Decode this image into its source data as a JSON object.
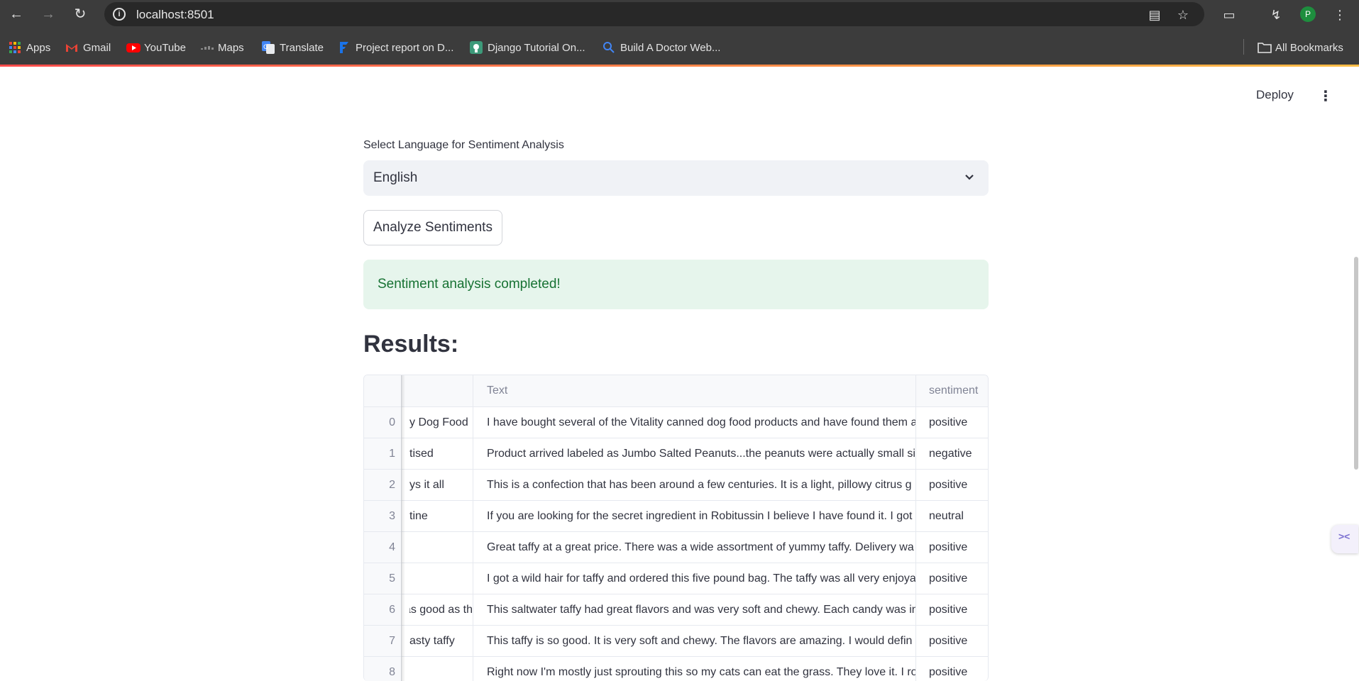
{
  "browser": {
    "url": "localhost:8501",
    "profile_initial": "P",
    "bookmarks": [
      {
        "label": "Apps",
        "icon": "apps-grid-icon",
        "color": "#ea4335"
      },
      {
        "label": "Gmail",
        "icon": "gmail-icon",
        "color": "#ea4335"
      },
      {
        "label": "YouTube",
        "icon": "youtube-icon",
        "color": "#ff0000"
      },
      {
        "label": "Maps",
        "icon": "maps-icon",
        "color": "#8a8a8a"
      },
      {
        "label": "Translate",
        "icon": "translate-icon",
        "color": "#4285f4"
      },
      {
        "label": "Project report on D...",
        "icon": "project-report-icon",
        "color": "#1a73e8"
      },
      {
        "label": "Django Tutorial On...",
        "icon": "django-icon",
        "color": "#3d9a7a"
      },
      {
        "label": "Build A Doctor Web...",
        "icon": "search-icon",
        "color": "#4285f4"
      }
    ],
    "all_bookmarks": "All Bookmarks"
  },
  "app": {
    "deploy_label": "Deploy",
    "select_label": "Select Language for Sentiment Analysis",
    "select_value": "English",
    "analyze_button": "Analyze Sentiments",
    "success_message": "Sentiment analysis completed!",
    "results_title": "Results:"
  },
  "table": {
    "columns": [
      "Text",
      "sentiment"
    ],
    "rows": [
      {
        "index": "0",
        "summary": "y Dog Food",
        "text": "I have bought several of the Vitality canned dog food products and have found them a",
        "sentiment": "positive"
      },
      {
        "index": "1",
        "summary": "tised",
        "text": "Product arrived labeled as Jumbo Salted Peanuts...the peanuts were actually small si",
        "sentiment": "negative"
      },
      {
        "index": "2",
        "summary": "ys it all",
        "text": "This is a confection that has been around a few centuries.  It is a light, pillowy citrus g",
        "sentiment": "positive"
      },
      {
        "index": "3",
        "summary": "tine",
        "text": "If you are looking for the secret ingredient in Robitussin I believe I have found it.  I got",
        "sentiment": "neutral"
      },
      {
        "index": "4",
        "summary": "",
        "text": "Great taffy at a great price.  There was a wide assortment of yummy taffy.  Delivery wa",
        "sentiment": "positive"
      },
      {
        "index": "5",
        "summary": "",
        "text": "I got a wild hair for taffy and ordered this five pound bag. The taffy was all very enjoya",
        "sentiment": "positive"
      },
      {
        "index": "6",
        "summary": "as good as th",
        "text": "This saltwater taffy had great flavors and was very soft and chewy.  Each candy was in",
        "sentiment": "positive"
      },
      {
        "index": "7",
        "summary": "asty taffy",
        "text": "This taffy is so good.  It is very soft and chewy.  The flavors are amazing.  I would defin",
        "sentiment": "positive"
      },
      {
        "index": "8",
        "summary": "",
        "text": "Right now I'm mostly just sprouting this so my cats can eat the grass. They love it. I ro",
        "sentiment": "positive"
      }
    ]
  },
  "colors": {
    "accent_red": "#ff4b4b",
    "accent_yellow": "#ffbd45",
    "success_bg": "#e6f5ec",
    "success_text": "#177233"
  }
}
